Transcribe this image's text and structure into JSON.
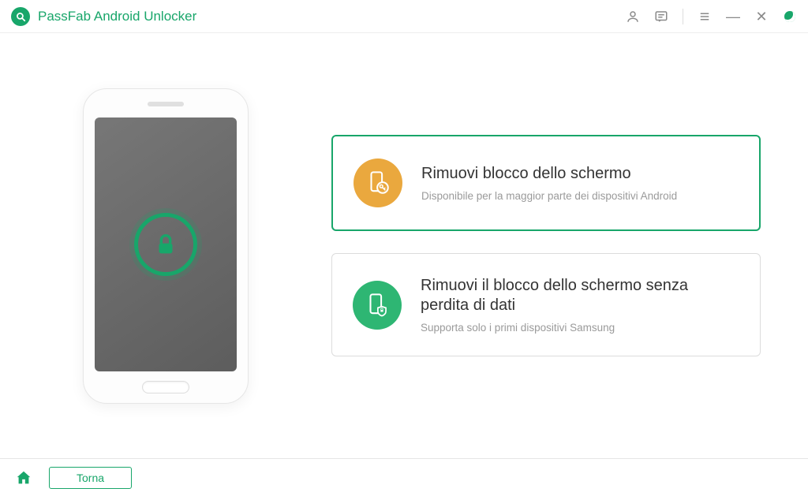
{
  "app": {
    "title": "PassFab Android Unlocker"
  },
  "options": [
    {
      "title": "Rimuovi blocco dello schermo",
      "subtitle": "Disponibile per la maggior parte dei dispositivi Android",
      "selected": true,
      "iconColor": "#eaa83e",
      "iconName": "phone-key-icon"
    },
    {
      "title": "Rimuovi il blocco dello schermo senza perdita di dati",
      "subtitle": "Supporta solo i primi dispositivi Samsung",
      "selected": false,
      "iconColor": "#2eb673",
      "iconName": "phone-shield-icon"
    }
  ],
  "footer": {
    "back_label": "Torna"
  }
}
